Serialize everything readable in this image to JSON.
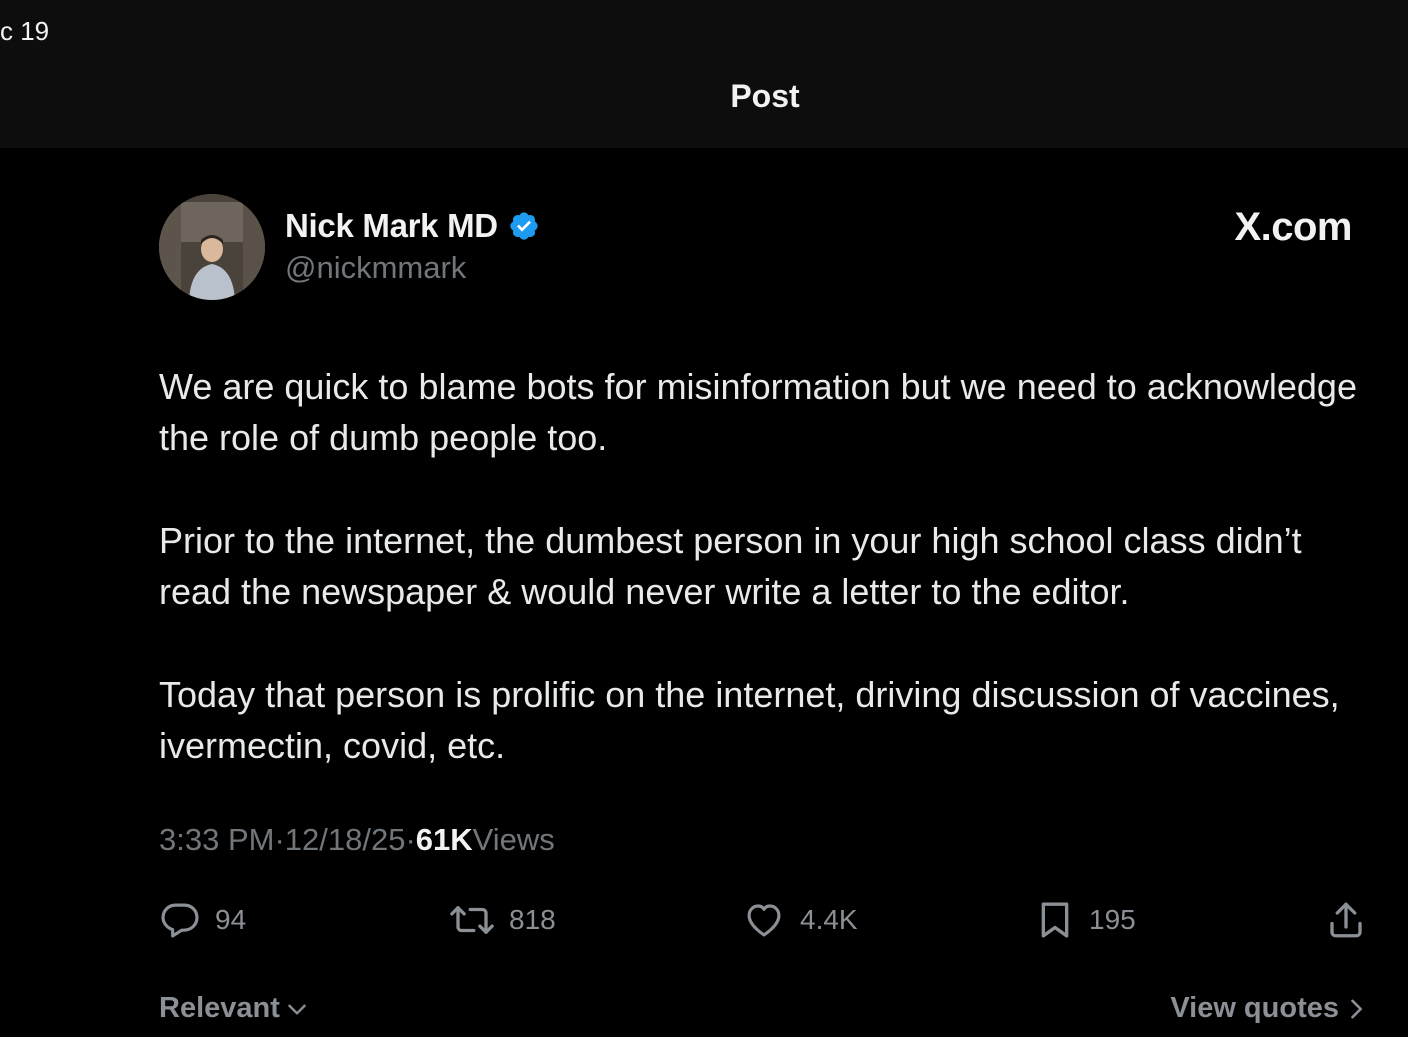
{
  "status_bar": {
    "fragment": "c 19"
  },
  "header": {
    "title": "Post"
  },
  "author": {
    "name": "Nick Mark MD",
    "handle": "@nickmmark",
    "verified": true
  },
  "brand": {
    "site": "X.com"
  },
  "tweet": {
    "paragraphs": [
      "We are quick to blame bots for misinformation but we need to acknowledge the role of dumb people too.",
      "Prior to the internet, the dumbest person in your high school class didn’t read the newspaper & would never write a letter to the editor.",
      "Today that person is prolific on the internet, driving discussion of vaccines, ivermectin, covid, etc."
    ]
  },
  "meta": {
    "time": "3:33 PM",
    "separator": " · ",
    "date": "12/18/25",
    "views_count": "61K",
    "views_label": " Views"
  },
  "actions": {
    "replies": {
      "icon": "reply-icon",
      "count": "94"
    },
    "reposts": {
      "icon": "repost-icon",
      "count": "818"
    },
    "likes": {
      "icon": "heart-icon",
      "count": "4.4K"
    },
    "bookmarks": {
      "icon": "bookmark-icon",
      "count": "195"
    },
    "share": {
      "icon": "share-icon"
    }
  },
  "footer": {
    "sort_label": "Relevant",
    "view_quotes_label": "View quotes"
  },
  "colors": {
    "background": "#000000",
    "header_bg": "#0d0d0d",
    "text_primary": "#e7e9ea",
    "text_secondary": "#71767b",
    "verified_blue": "#1d9bf0"
  }
}
